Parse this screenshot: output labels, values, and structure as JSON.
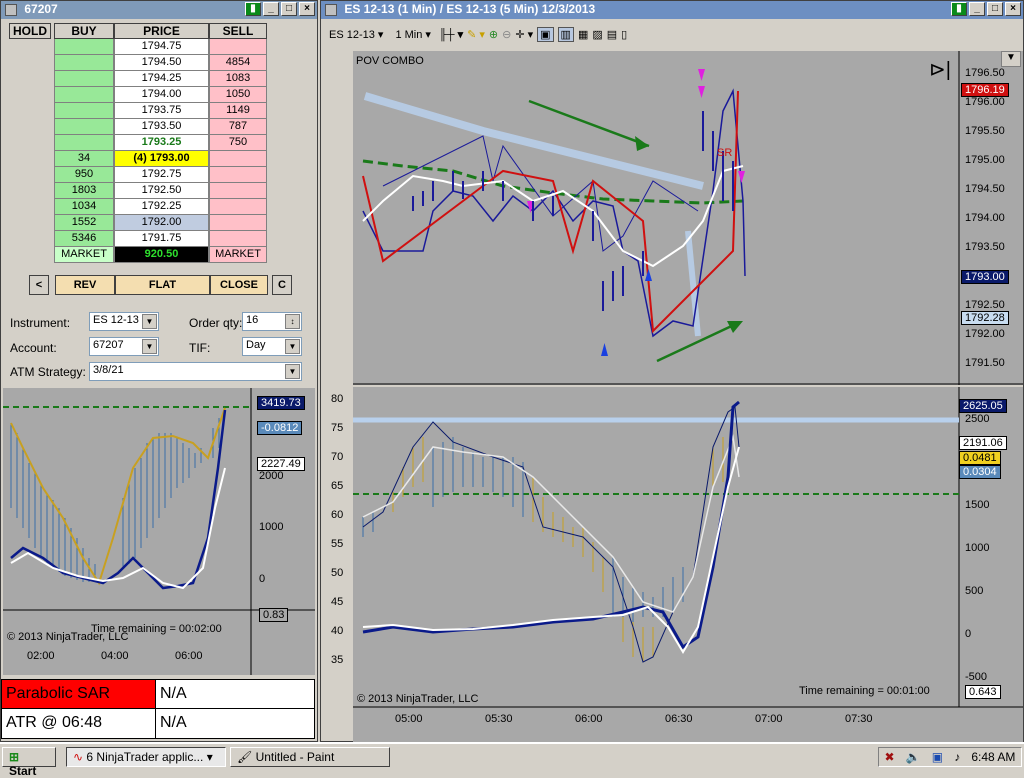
{
  "left_window": {
    "title": "67207",
    "dom_headers": {
      "hold": "HOLD",
      "buy": "BUY",
      "price": "PRICE",
      "sell": "SELL"
    },
    "ladder": [
      {
        "buy": "",
        "price": "1794.75",
        "sell": ""
      },
      {
        "buy": "",
        "price": "1794.50",
        "sell": "4854"
      },
      {
        "buy": "",
        "price": "1794.25",
        "sell": "1083"
      },
      {
        "buy": "",
        "price": "1794.00",
        "sell": "1050"
      },
      {
        "buy": "",
        "price": "1793.75",
        "sell": "1149"
      },
      {
        "buy": "",
        "price": "1793.50",
        "sell": "787"
      },
      {
        "buy": "",
        "price": "1793.25",
        "sell": "750"
      },
      {
        "buy": "34",
        "price": "(4) 1793.00",
        "sell": ""
      },
      {
        "buy": "950",
        "price": "1792.75",
        "sell": ""
      },
      {
        "buy": "1803",
        "price": "1792.50",
        "sell": ""
      },
      {
        "buy": "1034",
        "price": "1792.25",
        "sell": ""
      },
      {
        "buy": "1552",
        "price": "1792.00",
        "sell": ""
      },
      {
        "buy": "5346",
        "price": "1791.75",
        "sell": ""
      },
      {
        "buy": "MARKET",
        "price": "920.50",
        "sell": "MARKET"
      }
    ],
    "buttons": {
      "left": "<",
      "rev": "REV",
      "flat": "FLAT",
      "close": "CLOSE",
      "c": "C"
    },
    "form": {
      "instrument_label": "Instrument:",
      "instrument_value": "ES 12-13",
      "order_qty_label": "Order qty:",
      "order_qty_value": "16",
      "account_label": "Account:",
      "account_value": "67207",
      "tif_label": "TIF:",
      "tif_value": "Day",
      "atm_label": "ATM Strategy:",
      "atm_value": "3/8/21"
    },
    "chart": {
      "y_ticks": [
        "2000",
        "1000",
        "0"
      ],
      "tags": [
        "3419.73",
        "-0.0812",
        "2227.49",
        "0.83"
      ],
      "x_ticks": [
        "02:00",
        "04:00",
        "06:00"
      ],
      "time_remaining": "Time remaining = 00:02:00",
      "copyright": "© 2013 NinjaTrader, LLC"
    },
    "indicators": [
      {
        "name": "Parabolic SAR",
        "value": "N/A",
        "color": "#ff0000"
      },
      {
        "name": "ATR @ 06:48",
        "value": "N/A",
        "color": "#ffffff"
      }
    ]
  },
  "right_window": {
    "title": "ES 12-13 (1 Min) / ES 12-13 (5 Min)  12/3/2013",
    "toolbar": {
      "instrument": "ES 12-13",
      "interval": "1 Min"
    },
    "chart_label": "POV COMBO",
    "price_ticks": [
      "1796.50",
      "1796.00",
      "1795.50",
      "1795.00",
      "1794.50",
      "1794.00",
      "1793.50",
      "1793.00",
      "1792.50",
      "1792.00",
      "1791.50"
    ],
    "price_tags": {
      "top": "1796.19",
      "mid": "1793.00",
      "low": "1792.28"
    },
    "annotation": "SR",
    "osc_left_ticks": [
      "80",
      "75",
      "70",
      "65",
      "60",
      "55",
      "50",
      "45",
      "40",
      "35"
    ],
    "osc_right_ticks": [
      "2500",
      "2000",
      "1500",
      "1000",
      "500",
      "0",
      "-500"
    ],
    "osc_tags": [
      "2625.05",
      "2191.06",
      "0.0481",
      "0.0304",
      "0.643"
    ],
    "x_ticks": [
      "05:00",
      "05:30",
      "06:00",
      "06:30",
      "07:00",
      "07:30"
    ],
    "time_remaining": "Time remaining = 00:01:00",
    "copyright": "© 2013 NinjaTrader, LLC"
  },
  "taskbar": {
    "start": "Start",
    "task1": "6 NinjaTrader applic...",
    "task2": "Untitled - Paint",
    "clock": "6:48 AM"
  }
}
